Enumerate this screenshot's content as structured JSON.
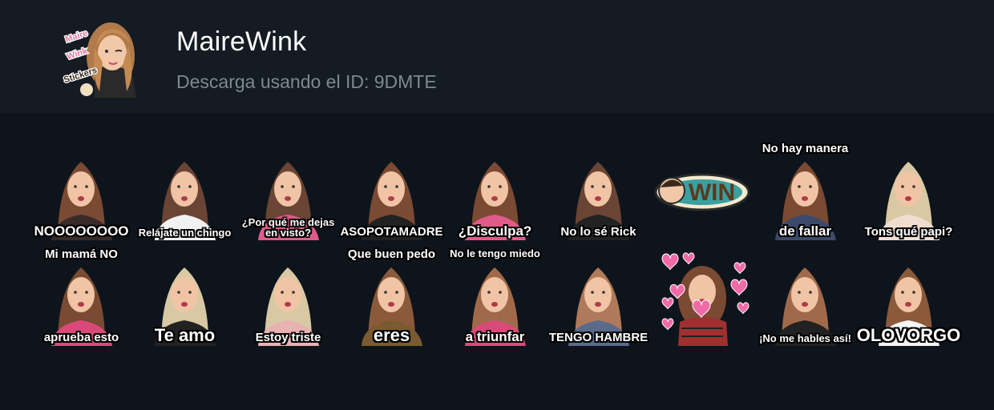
{
  "pack": {
    "title": "MaireWink",
    "subtitle": "Descarga usando el ID: 9DMTE",
    "icon_name": "mairewink-pack-icon",
    "icon_caption": "Maire Wink Stickers"
  },
  "colors": {
    "background": "#0e141b",
    "header_background": "#141b23",
    "title": "#ffffff",
    "subtitle": "#7f8790"
  },
  "stickers": [
    {
      "top": "",
      "bottom": "NOOOOOOOO",
      "hair": "#7a4a32",
      "top_color": "#3a2a2a"
    },
    {
      "top": "",
      "bottom": "Relájate un chingo",
      "hair": "#6a4434",
      "top_color": "#f1f1f1"
    },
    {
      "top": "",
      "bottom": "¿Por qué me dejas en visto?",
      "hair": "#6a4434",
      "top_color": "#e05a8a"
    },
    {
      "top": "",
      "bottom": "ASOPOTAMADRE",
      "hair": "#7a4a32",
      "top_color": "#222"
    },
    {
      "top": "",
      "bottom": "¿Disculpa?",
      "hair": "#7a4a32",
      "top_color": "#e05a8a"
    },
    {
      "top": "",
      "bottom": "No lo sé Rick",
      "hair": "#6a4434",
      "top_color": "#222"
    },
    {
      "top": "",
      "bottom": "",
      "hair": "#000",
      "top_color": "#000"
    },
    {
      "top": "No hay manera",
      "bottom": "de fallar",
      "hair": "#7a4a32",
      "top_color": "#3b4a6a"
    },
    {
      "top": "",
      "bottom": "Tons qué papi?",
      "hair": "#d8c9a4",
      "top_color": "#f1ddd0"
    },
    {
      "top": "Mi mamá NO",
      "bottom": "aprueba esto",
      "hair": "#7a4a32",
      "top_color": "#d94a7a"
    },
    {
      "top": "",
      "bottom": "Te amo",
      "hair": "#d8c9a4",
      "top_color": "#222"
    },
    {
      "top": "",
      "bottom": "Estoy triste",
      "hair": "#d8c9a4",
      "top_color": "#e8b2b2"
    },
    {
      "top": "Que buen pedo",
      "bottom": "eres",
      "hair": "#8a5a3a",
      "top_color": "#7a5a30"
    },
    {
      "top": "No le tengo miedo",
      "bottom": "a triunfar",
      "hair": "#a06a4a",
      "top_color": "#d94a7a"
    },
    {
      "top": "",
      "bottom": "TENGO HAMBRE",
      "hair": "#b07a5a",
      "top_color": "#5a6a8a"
    },
    {
      "top": "",
      "bottom": "",
      "hair": "#7a4a32",
      "top_color": "#a03030"
    },
    {
      "top": "",
      "bottom": "¡No me hables así!",
      "hair": "#a06a4a",
      "top_color": "#222"
    },
    {
      "top": "",
      "bottom": "OLOVORGO",
      "hair": "#8a5a3a",
      "top_color": "#f4f4f4"
    }
  ]
}
